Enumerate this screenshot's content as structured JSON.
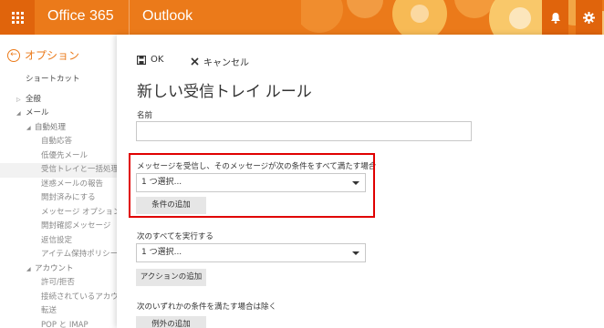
{
  "topbar": {
    "brand": "Office 365",
    "app": "Outlook",
    "icons": [
      "waffle-icon",
      "bell-icon",
      "gear-icon"
    ],
    "accent": "#eb7a1a"
  },
  "options": {
    "back_label": "オプション",
    "items": [
      {
        "label": "ショートカット",
        "level": 0
      },
      {
        "label": "全般",
        "level": 1,
        "arrow": "▷"
      },
      {
        "label": "メール",
        "level": 1,
        "arrow": "◢"
      },
      {
        "label": "自動処理",
        "level": 2,
        "arrow": "◢"
      },
      {
        "label": "自動応答",
        "level": 3
      },
      {
        "label": "低優先メール",
        "level": 3
      },
      {
        "label": "受信トレイと一括処理ルール",
        "level": 3,
        "selected": true
      },
      {
        "label": "迷惑メールの報告",
        "level": 3
      },
      {
        "label": "開封済みにする",
        "level": 3
      },
      {
        "label": "メッセージ オプション",
        "level": 3
      },
      {
        "label": "開封確認メッセージ",
        "level": 3
      },
      {
        "label": "返信設定",
        "level": 3
      },
      {
        "label": "アイテム保持ポリシー",
        "level": 3
      },
      {
        "label": "アカウント",
        "level": 2,
        "arrow": "◢"
      },
      {
        "label": "許可/拒否",
        "level": 3
      },
      {
        "label": "接続されているアカウント",
        "level": 3
      },
      {
        "label": "転送",
        "level": 3
      },
      {
        "label": "POP と IMAP",
        "level": 3
      }
    ]
  },
  "dialog": {
    "ok_label": "OK",
    "cancel_label": "キャンセル",
    "title": "新しい受信トレイ ルール",
    "name_label": "名前",
    "name_value": "",
    "condition_label": "メッセージを受信し、そのメッセージが次の条件をすべて満たす場合",
    "condition_select": "1 つ選択...",
    "add_condition": "条件の追加",
    "action_label": "次のすべてを実行する",
    "action_select": "1 つ選択...",
    "add_action": "アクションの追加",
    "exception_label": "次のいずれかの条件を満たす場合は除く",
    "add_exception": "例外の追加"
  },
  "highlight_color": "#e00000"
}
